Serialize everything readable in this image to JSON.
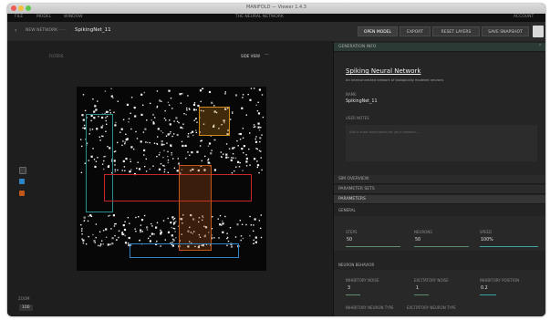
{
  "window": {
    "title": "MANIFOLD — Viewer 1.4.3"
  },
  "menu": [
    "FILE",
    "MODEL",
    "WINDOW"
  ],
  "menu_right": "ACCOUNT",
  "top_label": "THE NEURAL NETWORK",
  "toolbar": {
    "breadcrumb": "NEW NETWORK",
    "file_name": "SpikingNet_11",
    "buttons": [
      "OPEN MODEL",
      "EXPORT",
      "RESET LAYERS",
      "SAVE SNAPSHOT"
    ]
  },
  "viewer": {
    "top_left": "FILTERS",
    "top_right": "SIDE VIEW",
    "zoom_label": "ZOOM",
    "zoom_value": "100"
  },
  "sidebar": {
    "generation_info": {
      "header": "GENERATION INFO",
      "title": "Spiking Neural Network",
      "subtitle": "An interconnected network of biologically modeled neurons",
      "name_label": "NAME",
      "name_value": "SpikingNet_11",
      "notes_label": "USER NOTES",
      "notes_placeholder": "Add a short description for your network..."
    },
    "sections": [
      "SIM OVERVIEW",
      "PARAMETER SETS",
      "PARAMETERS"
    ],
    "general": {
      "header": "GENERAL",
      "fields": [
        {
          "label": "STEPS",
          "value": "50"
        },
        {
          "label": "NEURONS",
          "value": "50"
        },
        {
          "label": "SPEED",
          "value": "100%"
        }
      ]
    },
    "neuron_behavior": {
      "header": "NEURON BEHAVIOR",
      "fields": [
        {
          "label": "INHIBITORY NOISE",
          "value": "3"
        },
        {
          "label": "EXCITATORY NOISE",
          "value": "1"
        },
        {
          "label": "INHIBITORY POSITION",
          "value": "0.2"
        }
      ],
      "more": [
        "INHIBITORY NEURON TYPE",
        "EXCITATORY NEURON TYPE"
      ]
    }
  },
  "colors": {
    "teal": "#2b8f8f",
    "red": "#c62828",
    "orange": "#c2571a",
    "blue": "#2f86c7",
    "highlight": "#d18a1a"
  }
}
